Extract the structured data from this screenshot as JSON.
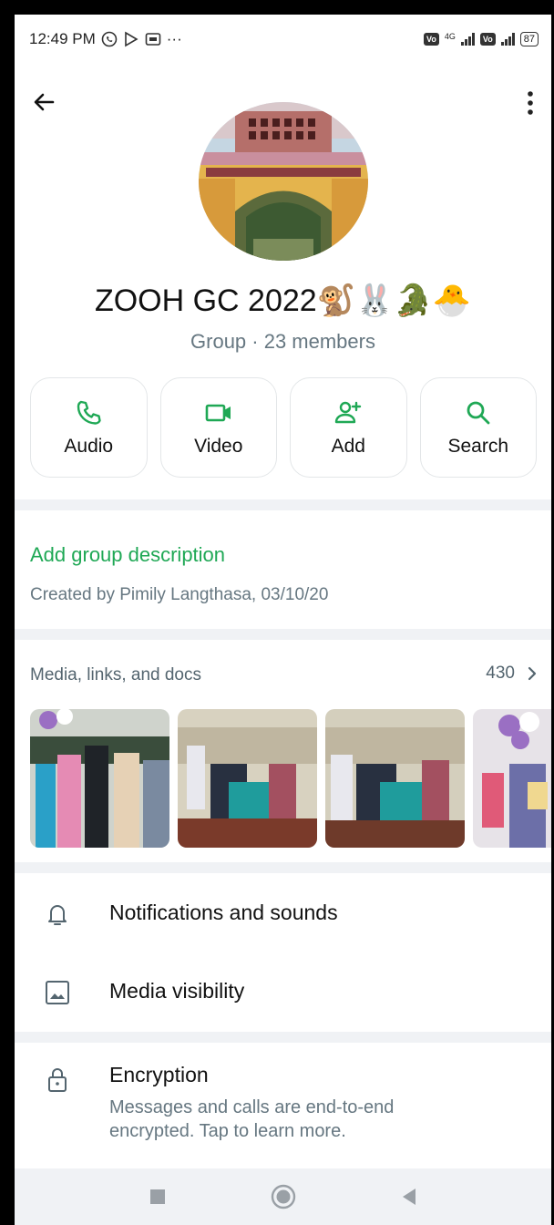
{
  "status": {
    "time": "12:49 PM",
    "dots": "···",
    "network": "4G",
    "battery": "87"
  },
  "group": {
    "name": "ZOOH GC 2022🐒🐰🐊🐣",
    "subtitle": "Group · 23 members"
  },
  "actions": [
    {
      "label": "Audio",
      "icon": "phone-icon"
    },
    {
      "label": "Video",
      "icon": "video-icon"
    },
    {
      "label": "Add",
      "icon": "add-person-icon"
    },
    {
      "label": "Search",
      "icon": "search-icon"
    }
  ],
  "description": {
    "add_label": "Add group description",
    "created_by": "Created by Pimily Langthasa, 03/10/20"
  },
  "media": {
    "header": "Media, links, and docs",
    "count": "430"
  },
  "settings": {
    "notifications": "Notifications and sounds",
    "media_visibility": "Media visibility",
    "encryption_title": "Encryption",
    "encryption_sub": "Messages and calls are end-to-end encrypted. Tap to learn more."
  },
  "colors": {
    "accent": "#1fa855",
    "divider": "#f0f2f5",
    "muted": "#667781"
  }
}
